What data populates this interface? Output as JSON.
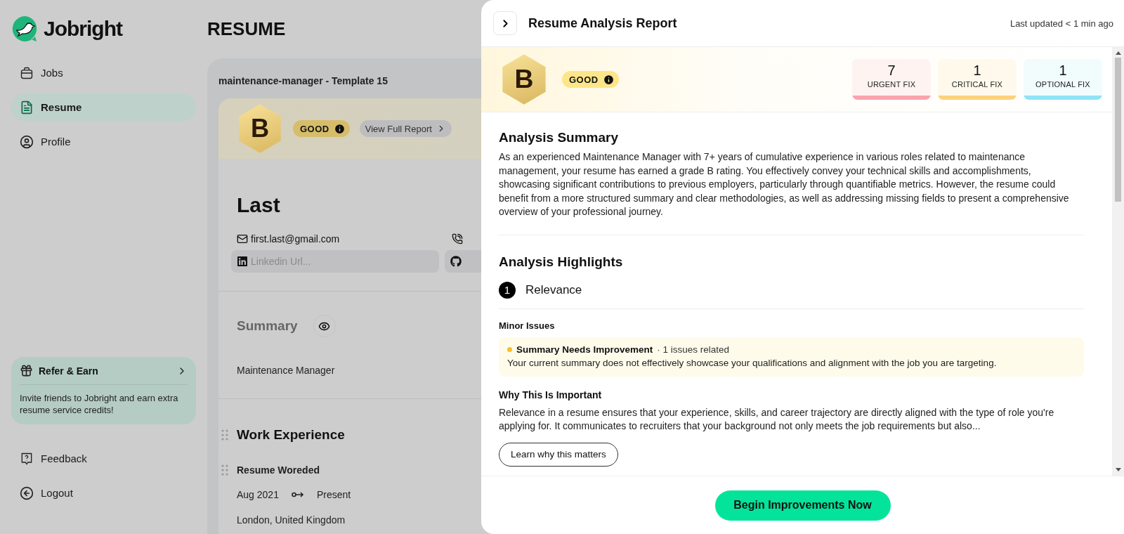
{
  "logo": {
    "text": "Jobright"
  },
  "sidebar": {
    "items": [
      {
        "kind": "jobs",
        "label": "Jobs",
        "selected": false
      },
      {
        "kind": "resume",
        "label": "Resume",
        "selected": true
      },
      {
        "kind": "profile",
        "label": "Profile",
        "selected": false
      }
    ],
    "refer": {
      "title": "Refer & Earn",
      "text": "Invite friends to Jobright and earn extra resume service credits!"
    },
    "footer_items": [
      {
        "kind": "feedback",
        "label": "Feedback"
      },
      {
        "kind": "logout",
        "label": "Logout"
      }
    ]
  },
  "page": {
    "title": "RESUME"
  },
  "resume": {
    "name": "maintenance-manager - Template 15",
    "grade": "B",
    "rating": "GOOD",
    "report_link": "View Full Report",
    "person_name": "Last",
    "email": "first.last@gmail.com",
    "linkedin": {
      "placeholder": "Linkedin Url..."
    },
    "summary_heading": "Summary",
    "summary_text": "Maintenance Manager",
    "work_heading": "Work Experience",
    "job": {
      "company": "Resume Woreded",
      "start": "Aug 2021",
      "end": "Present",
      "location": "London, United Kingdom"
    }
  },
  "report": {
    "title": "Resume Analysis Report",
    "updated": "Last updated < 1 min ago",
    "grade": "B",
    "rating": "GOOD",
    "fixes": [
      {
        "count": "7",
        "label": "URGENT FIX",
        "color": "#f9a3ad"
      },
      {
        "count": "1",
        "label": "CRITICAL FIX",
        "color": "#fcd27c"
      },
      {
        "count": "1",
        "label": "OPTIONAL FIX",
        "color": "#8ee3f5"
      }
    ],
    "summary_heading": "Analysis Summary",
    "summary_text": "As an experienced Maintenance Manager with 7+ years of cumulative experience in various roles related to maintenance management, your resume has earned a grade B rating. You effectively convey your technical skills and accomplishments, showcasing significant contributions to previous employers, particularly through quantifiable metrics. However, the resume could benefit from a more structured summary and clear methodologies, as well as addressing missing fields to present a comprehensive overview of your professional journey.",
    "highlights_heading": "Analysis Highlights",
    "highlights": [
      {
        "number": "1",
        "title": "Relevance",
        "issue_group": "Minor Issues",
        "issues": [
          {
            "title": "Summary Needs Improvement",
            "meta": "· 1 issues related",
            "text": "Your current summary does not effectively showcase your qualifications and alignment with the job you are targeting."
          }
        ],
        "why_heading": "Why This Is Important",
        "why_text": "Relevance in a resume ensures that your experience, skills, and career trajectory are directly aligned with the type of role you're applying for. It communicates to recruiters that your background not only meets the job requirements but also...",
        "button": "Learn why this matters"
      }
    ],
    "cta": "Begin Improvements Now"
  }
}
